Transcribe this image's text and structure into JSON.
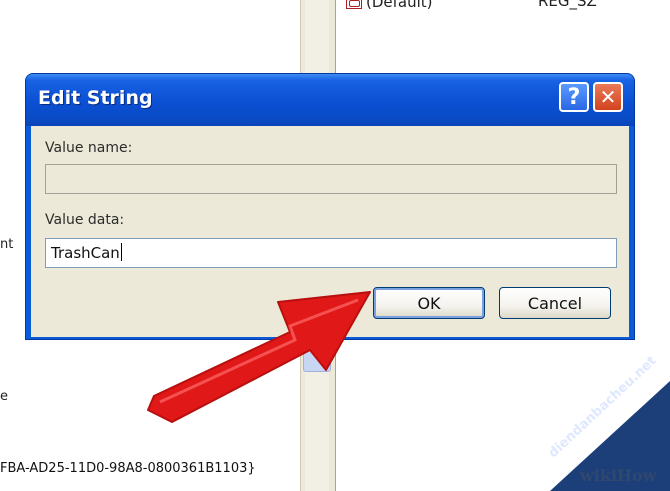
{
  "background": {
    "left_fragments": [
      "nt",
      "e"
    ],
    "registry_value_name": "(Default)",
    "registry_value_type": "REG_SZ",
    "clsid_text": "FBA-AD25-11D0-98A8-0800361B1103}"
  },
  "dialog": {
    "title": "Edit String",
    "help_glyph": "?",
    "close_glyph": "✕",
    "value_name_label": "Value name:",
    "value_name": "",
    "value_data_label": "Value data:",
    "value_data": "TrashCan",
    "ok_label": "OK",
    "cancel_label": "Cancel"
  },
  "annotation": {
    "arrow_color": "#e01818"
  },
  "watermark": {
    "site": "diendanbacheu.net",
    "brand": "wikiHow"
  },
  "colors": {
    "titlebar": "#0b4fd3",
    "dialog_face": "#ece9d8",
    "close_button": "#d2421e"
  }
}
